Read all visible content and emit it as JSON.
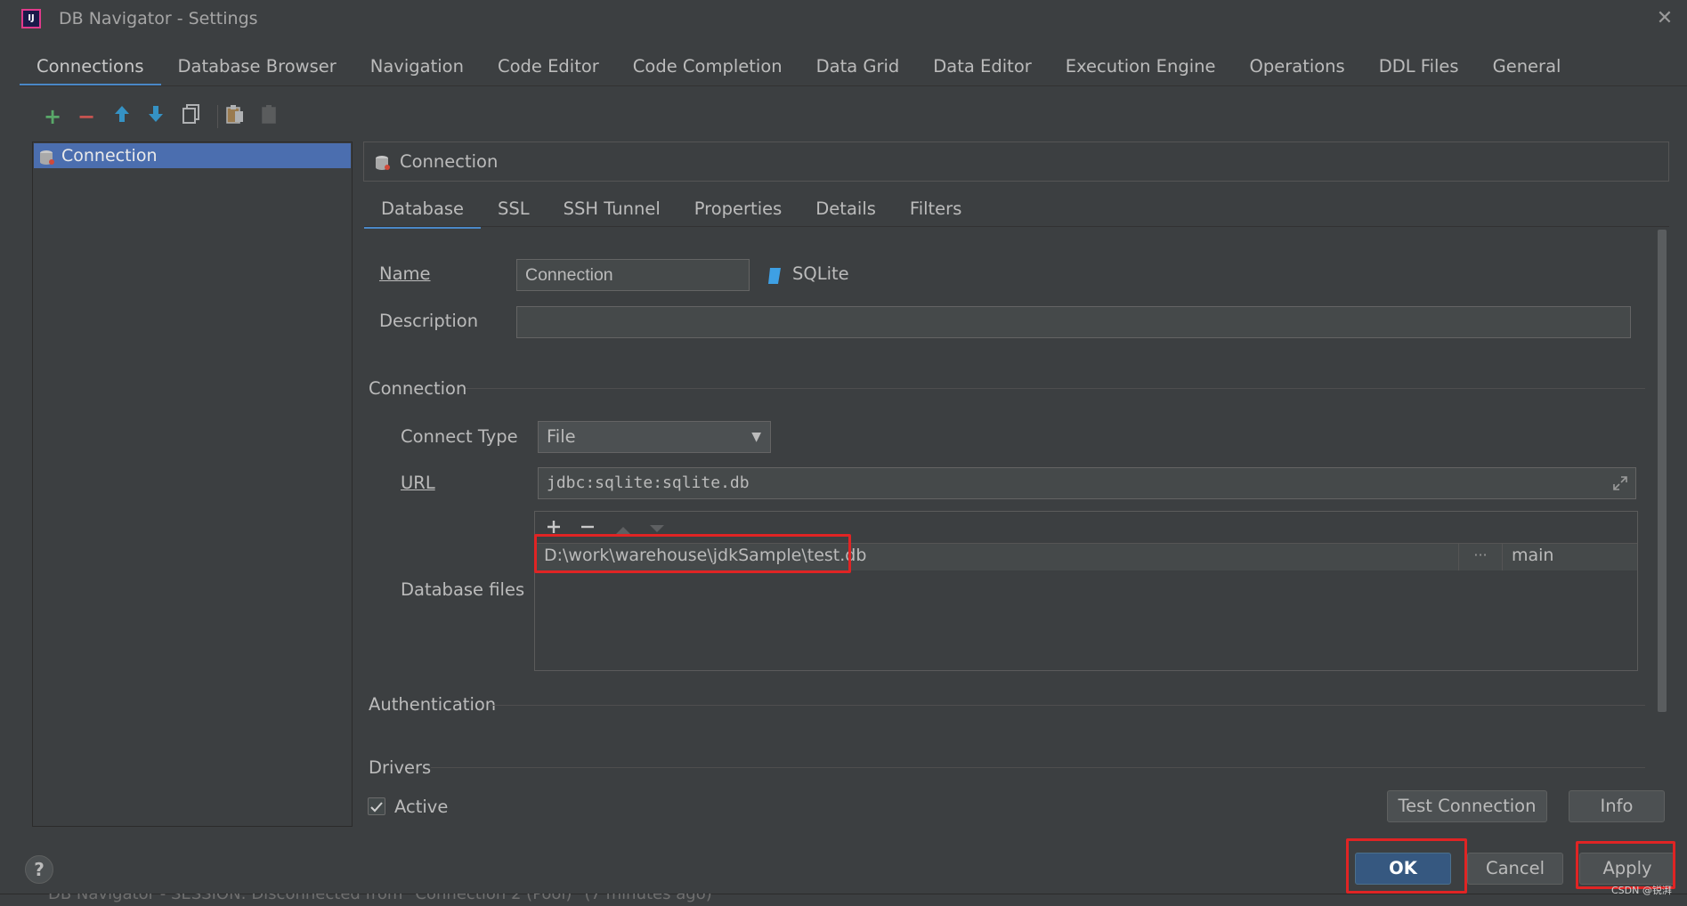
{
  "window": {
    "title": "DB Navigator - Settings",
    "app_icon_text": "IJ",
    "close_glyph": "✕"
  },
  "top_tabs": [
    {
      "label": "Connections",
      "active": true
    },
    {
      "label": "Database Browser"
    },
    {
      "label": "Navigation"
    },
    {
      "label": "Code Editor"
    },
    {
      "label": "Code Completion"
    },
    {
      "label": "Data Grid"
    },
    {
      "label": "Data Editor"
    },
    {
      "label": "Execution Engine"
    },
    {
      "label": "Operations"
    },
    {
      "label": "DDL Files"
    },
    {
      "label": "General"
    }
  ],
  "toolbar": {
    "add_glyph": "+",
    "remove_glyph": "−",
    "up_glyph": "🡑",
    "down_glyph": "🡓"
  },
  "tree": {
    "items": [
      {
        "label": "Connection",
        "selected": true
      }
    ]
  },
  "header": {
    "label": "Connection"
  },
  "sub_tabs": [
    {
      "label": "Database",
      "active": true
    },
    {
      "label": "SSL"
    },
    {
      "label": "SSH Tunnel"
    },
    {
      "label": "Properties"
    },
    {
      "label": "Details"
    },
    {
      "label": "Filters"
    }
  ],
  "form": {
    "name_label": "Name",
    "name_value": "Connection",
    "db_type": "SQLite",
    "description_label": "Description",
    "description_value": "",
    "connection_section": "Connection",
    "connect_type_label": "Connect Type",
    "connect_type_value": "File",
    "url_label": "URL",
    "url_value": "jdbc:sqlite:sqlite.db",
    "database_files_label": "Database files",
    "authentication_section": "Authentication",
    "drivers_section": "Drivers",
    "active_label": "Active",
    "active_checked": true
  },
  "db_files": {
    "rows": [
      {
        "path": "D:\\work\\warehouse\\jdkSample\\test.db",
        "browse": "···",
        "schema": "main"
      }
    ]
  },
  "buttons": {
    "test_connection": "Test Connection",
    "info": "Info",
    "ok": "OK",
    "cancel": "Cancel",
    "apply": "Apply",
    "help": "?"
  },
  "status_bar": {
    "text": "DB Navigator - SESSION: Disconnected from \"Connection 2 (Pool)\" (7 minutes ago)"
  },
  "watermark": "CSDN @锐湃",
  "colors": {
    "background": "#3c3f41",
    "selection": "#4b6eaf",
    "tab_underline": "#4a88c7",
    "ok_button": "#365880",
    "highlight_box": "#e02424"
  }
}
